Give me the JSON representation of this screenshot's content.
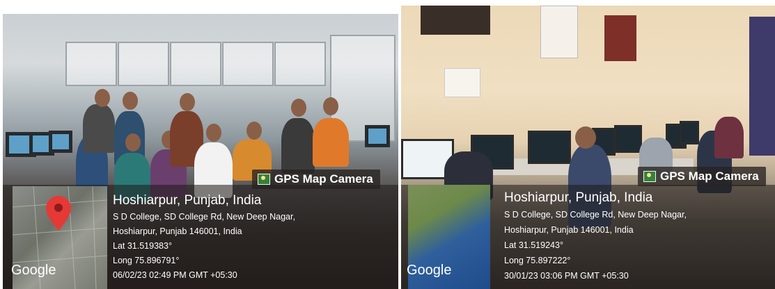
{
  "photos": [
    {
      "gps_label": "GPS Map Camera",
      "location_title": "Hoshiarpur, Punjab, India",
      "address_line1": "S D College, SD College Rd, New Deep Nagar,",
      "address_line2": "Hoshiarpur, Punjab 146001, India",
      "lat": "Lat 31.519383°",
      "long": "Long 75.896791°",
      "datetime": "06/02/23 02:49 PM GMT +05:30",
      "map_brand": "Google",
      "map_icon": "location-pin-icon"
    },
    {
      "gps_label": "GPS Map Camera",
      "location_title": "Hoshiarpur, Punjab, India",
      "address_line1": "S D College, SD College Rd, New Deep Nagar,",
      "address_line2": "Hoshiarpur, Punjab 146001, India",
      "lat": "Lat 31.519243°",
      "long": "Long 75.897222°",
      "datetime": "30/01/23 03:06 PM GMT +05:30",
      "map_brand": "Google"
    }
  ]
}
